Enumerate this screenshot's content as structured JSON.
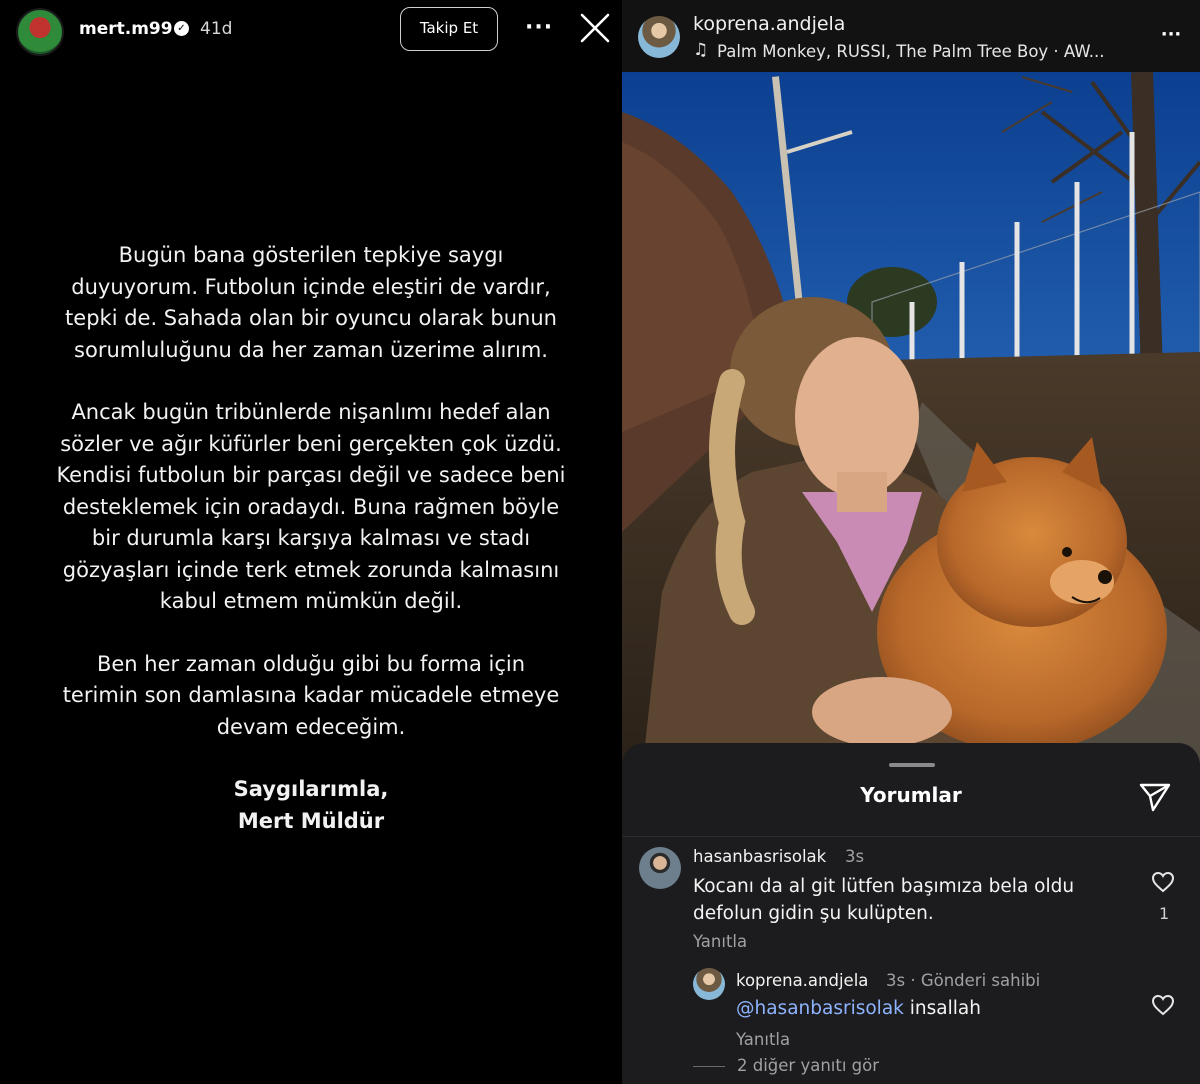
{
  "story": {
    "username": "mert.m99",
    "verified_icon": "verified-badge-icon",
    "age": "41d",
    "follow_label": "Takip Et",
    "more_icon": "more-horizontal-icon",
    "close_icon": "close-icon",
    "paragraphs": [
      [
        "Bugün bana gösterilen tepkiye saygı",
        "duyuyorum. Futbolun içinde eleştiri de vardır,",
        "tepki de. Sahada olan bir oyuncu olarak bunun",
        "sorumluluğunu da her zaman üzerime alırım."
      ],
      [
        "Ancak bugün tribünlerde nişanlımı hedef alan",
        "sözler ve ağır küfürler beni gerçekten çok üzdü.",
        "Kendisi futbolun bir parçası değil ve sadece beni",
        "desteklemek için oradaydı. Buna rağmen böyle",
        "bir durumla karşı karşıya kalması ve stadı",
        "gözyaşları içinde terk etmek zorunda kalmasını",
        "kabul etmem mümkün değil."
      ],
      [
        "Ben her zaman olduğu gibi bu forma için",
        "terimin son damlasına kadar mücadele etmeye",
        "devam edeceğim."
      ]
    ],
    "signature": [
      "Saygılarımla,",
      "Mert Müldür"
    ]
  },
  "post": {
    "username": "koprena.andjela",
    "music_icon": "music-note-icon",
    "music": "Palm Monkey, RUSSI, The Palm Tree Boy · AW...",
    "more_icon": "more-horizontal-icon"
  },
  "comments_sheet": {
    "title": "Yorumlar",
    "share_icon": "send-icon",
    "comments": [
      {
        "username": "hasanbasrisolak",
        "time": "3s",
        "text": [
          "Kocanı da al git lütfen başımıza bela oldu",
          "defolun gidin şu kulüpten."
        ],
        "reply_label": "Yanıtla",
        "likes": "1"
      },
      {
        "username": "koprena.andjela",
        "time": "3s · Gönderi sahibi",
        "mention": "@hasanbasrisolak",
        "text": "insallah",
        "reply_label": "Yanıtla"
      }
    ],
    "more_replies": "2 diğer yanıtı gör"
  }
}
